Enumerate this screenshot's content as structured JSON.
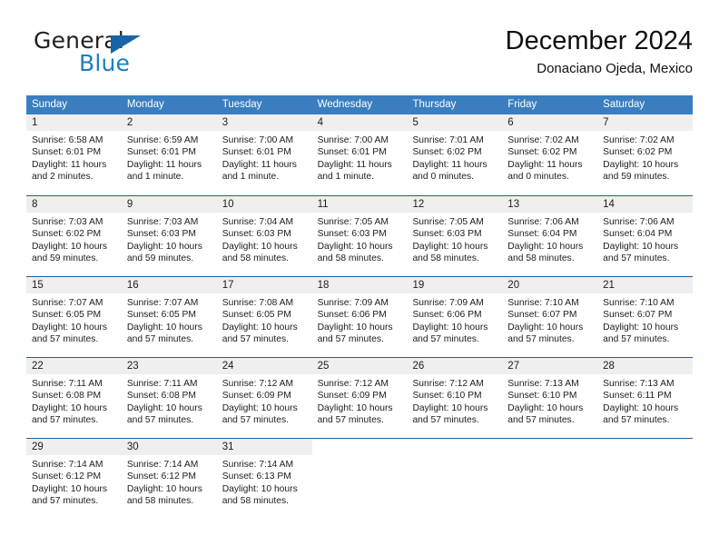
{
  "brand": {
    "name_part1": "General",
    "name_part2": "Blue",
    "triangle_icon": "triangle-icon",
    "color_dark": "#231f20",
    "color_blue": "#1a7fc1"
  },
  "header": {
    "title": "December 2024",
    "subtitle": "Donaciano Ojeda, Mexico"
  },
  "theme": {
    "header_bg": "#3a7ebf",
    "header_text": "#ffffff",
    "row_divider": "#1f5fa0",
    "day_band_bg": "#efefef",
    "cell_bg": "#ffffff",
    "text": "#1c1c1c"
  },
  "weekdays": [
    "Sunday",
    "Monday",
    "Tuesday",
    "Wednesday",
    "Thursday",
    "Friday",
    "Saturday"
  ],
  "weeks": [
    [
      {
        "day": "1",
        "sunrise": "Sunrise: 6:58 AM",
        "sunset": "Sunset: 6:01 PM",
        "daylight_line1": "Daylight: 11 hours",
        "daylight_line2": "and 2 minutes."
      },
      {
        "day": "2",
        "sunrise": "Sunrise: 6:59 AM",
        "sunset": "Sunset: 6:01 PM",
        "daylight_line1": "Daylight: 11 hours",
        "daylight_line2": "and 1 minute."
      },
      {
        "day": "3",
        "sunrise": "Sunrise: 7:00 AM",
        "sunset": "Sunset: 6:01 PM",
        "daylight_line1": "Daylight: 11 hours",
        "daylight_line2": "and 1 minute."
      },
      {
        "day": "4",
        "sunrise": "Sunrise: 7:00 AM",
        "sunset": "Sunset: 6:01 PM",
        "daylight_line1": "Daylight: 11 hours",
        "daylight_line2": "and 1 minute."
      },
      {
        "day": "5",
        "sunrise": "Sunrise: 7:01 AM",
        "sunset": "Sunset: 6:02 PM",
        "daylight_line1": "Daylight: 11 hours",
        "daylight_line2": "and 0 minutes."
      },
      {
        "day": "6",
        "sunrise": "Sunrise: 7:02 AM",
        "sunset": "Sunset: 6:02 PM",
        "daylight_line1": "Daylight: 11 hours",
        "daylight_line2": "and 0 minutes."
      },
      {
        "day": "7",
        "sunrise": "Sunrise: 7:02 AM",
        "sunset": "Sunset: 6:02 PM",
        "daylight_line1": "Daylight: 10 hours",
        "daylight_line2": "and 59 minutes."
      }
    ],
    [
      {
        "day": "8",
        "sunrise": "Sunrise: 7:03 AM",
        "sunset": "Sunset: 6:02 PM",
        "daylight_line1": "Daylight: 10 hours",
        "daylight_line2": "and 59 minutes."
      },
      {
        "day": "9",
        "sunrise": "Sunrise: 7:03 AM",
        "sunset": "Sunset: 6:03 PM",
        "daylight_line1": "Daylight: 10 hours",
        "daylight_line2": "and 59 minutes."
      },
      {
        "day": "10",
        "sunrise": "Sunrise: 7:04 AM",
        "sunset": "Sunset: 6:03 PM",
        "daylight_line1": "Daylight: 10 hours",
        "daylight_line2": "and 58 minutes."
      },
      {
        "day": "11",
        "sunrise": "Sunrise: 7:05 AM",
        "sunset": "Sunset: 6:03 PM",
        "daylight_line1": "Daylight: 10 hours",
        "daylight_line2": "and 58 minutes."
      },
      {
        "day": "12",
        "sunrise": "Sunrise: 7:05 AM",
        "sunset": "Sunset: 6:03 PM",
        "daylight_line1": "Daylight: 10 hours",
        "daylight_line2": "and 58 minutes."
      },
      {
        "day": "13",
        "sunrise": "Sunrise: 7:06 AM",
        "sunset": "Sunset: 6:04 PM",
        "daylight_line1": "Daylight: 10 hours",
        "daylight_line2": "and 58 minutes."
      },
      {
        "day": "14",
        "sunrise": "Sunrise: 7:06 AM",
        "sunset": "Sunset: 6:04 PM",
        "daylight_line1": "Daylight: 10 hours",
        "daylight_line2": "and 57 minutes."
      }
    ],
    [
      {
        "day": "15",
        "sunrise": "Sunrise: 7:07 AM",
        "sunset": "Sunset: 6:05 PM",
        "daylight_line1": "Daylight: 10 hours",
        "daylight_line2": "and 57 minutes."
      },
      {
        "day": "16",
        "sunrise": "Sunrise: 7:07 AM",
        "sunset": "Sunset: 6:05 PM",
        "daylight_line1": "Daylight: 10 hours",
        "daylight_line2": "and 57 minutes."
      },
      {
        "day": "17",
        "sunrise": "Sunrise: 7:08 AM",
        "sunset": "Sunset: 6:05 PM",
        "daylight_line1": "Daylight: 10 hours",
        "daylight_line2": "and 57 minutes."
      },
      {
        "day": "18",
        "sunrise": "Sunrise: 7:09 AM",
        "sunset": "Sunset: 6:06 PM",
        "daylight_line1": "Daylight: 10 hours",
        "daylight_line2": "and 57 minutes."
      },
      {
        "day": "19",
        "sunrise": "Sunrise: 7:09 AM",
        "sunset": "Sunset: 6:06 PM",
        "daylight_line1": "Daylight: 10 hours",
        "daylight_line2": "and 57 minutes."
      },
      {
        "day": "20",
        "sunrise": "Sunrise: 7:10 AM",
        "sunset": "Sunset: 6:07 PM",
        "daylight_line1": "Daylight: 10 hours",
        "daylight_line2": "and 57 minutes."
      },
      {
        "day": "21",
        "sunrise": "Sunrise: 7:10 AM",
        "sunset": "Sunset: 6:07 PM",
        "daylight_line1": "Daylight: 10 hours",
        "daylight_line2": "and 57 minutes."
      }
    ],
    [
      {
        "day": "22",
        "sunrise": "Sunrise: 7:11 AM",
        "sunset": "Sunset: 6:08 PM",
        "daylight_line1": "Daylight: 10 hours",
        "daylight_line2": "and 57 minutes."
      },
      {
        "day": "23",
        "sunrise": "Sunrise: 7:11 AM",
        "sunset": "Sunset: 6:08 PM",
        "daylight_line1": "Daylight: 10 hours",
        "daylight_line2": "and 57 minutes."
      },
      {
        "day": "24",
        "sunrise": "Sunrise: 7:12 AM",
        "sunset": "Sunset: 6:09 PM",
        "daylight_line1": "Daylight: 10 hours",
        "daylight_line2": "and 57 minutes."
      },
      {
        "day": "25",
        "sunrise": "Sunrise: 7:12 AM",
        "sunset": "Sunset: 6:09 PM",
        "daylight_line1": "Daylight: 10 hours",
        "daylight_line2": "and 57 minutes."
      },
      {
        "day": "26",
        "sunrise": "Sunrise: 7:12 AM",
        "sunset": "Sunset: 6:10 PM",
        "daylight_line1": "Daylight: 10 hours",
        "daylight_line2": "and 57 minutes."
      },
      {
        "day": "27",
        "sunrise": "Sunrise: 7:13 AM",
        "sunset": "Sunset: 6:10 PM",
        "daylight_line1": "Daylight: 10 hours",
        "daylight_line2": "and 57 minutes."
      },
      {
        "day": "28",
        "sunrise": "Sunrise: 7:13 AM",
        "sunset": "Sunset: 6:11 PM",
        "daylight_line1": "Daylight: 10 hours",
        "daylight_line2": "and 57 minutes."
      }
    ],
    [
      {
        "day": "29",
        "sunrise": "Sunrise: 7:14 AM",
        "sunset": "Sunset: 6:12 PM",
        "daylight_line1": "Daylight: 10 hours",
        "daylight_line2": "and 57 minutes."
      },
      {
        "day": "30",
        "sunrise": "Sunrise: 7:14 AM",
        "sunset": "Sunset: 6:12 PM",
        "daylight_line1": "Daylight: 10 hours",
        "daylight_line2": "and 58 minutes."
      },
      {
        "day": "31",
        "sunrise": "Sunrise: 7:14 AM",
        "sunset": "Sunset: 6:13 PM",
        "daylight_line1": "Daylight: 10 hours",
        "daylight_line2": "and 58 minutes."
      },
      {
        "day": "",
        "sunrise": "",
        "sunset": "",
        "daylight_line1": "",
        "daylight_line2": ""
      },
      {
        "day": "",
        "sunrise": "",
        "sunset": "",
        "daylight_line1": "",
        "daylight_line2": ""
      },
      {
        "day": "",
        "sunrise": "",
        "sunset": "",
        "daylight_line1": "",
        "daylight_line2": ""
      },
      {
        "day": "",
        "sunrise": "",
        "sunset": "",
        "daylight_line1": "",
        "daylight_line2": ""
      }
    ]
  ]
}
